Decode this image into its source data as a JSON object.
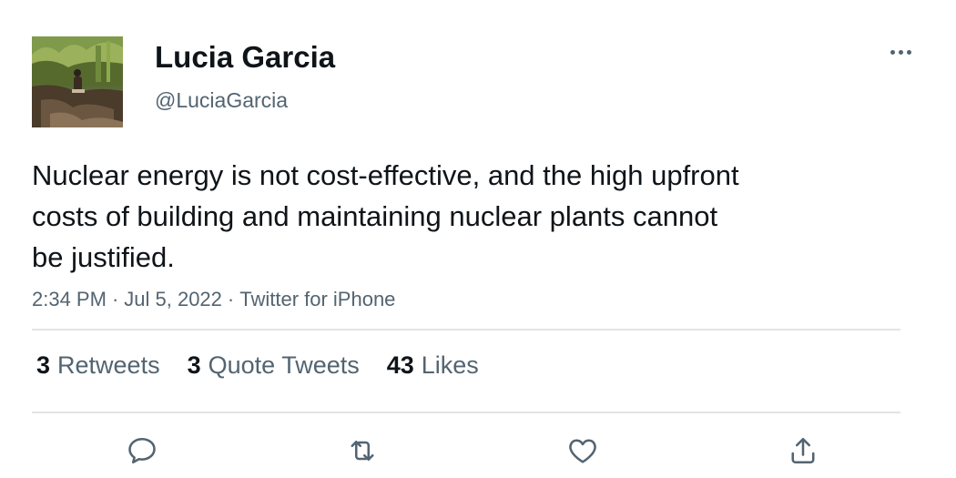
{
  "tweet": {
    "author": {
      "display_name": "Lucia Garcia",
      "handle": "@LuciaGarcia"
    },
    "text": "Nuclear energy is not cost-effective, and the high upfront costs of building and maintaining nuclear plants cannot be justified.",
    "time": "2:34 PM",
    "separator": "·",
    "date": "Jul 5, 2022",
    "source": "Twitter for iPhone"
  },
  "stats": {
    "retweets": {
      "count": "3",
      "label": "Retweets"
    },
    "quote_tweets": {
      "count": "3",
      "label": "Quote Tweets"
    },
    "likes": {
      "count": "43",
      "label": "Likes"
    }
  },
  "icons": {
    "more": "more-horizontal-icon",
    "reply": "reply-icon",
    "retweet": "retweet-icon",
    "like": "heart-icon",
    "share": "share-icon"
  },
  "colors": {
    "text_primary": "#0f1419",
    "text_secondary": "#536471",
    "divider": "#e1e4e6"
  }
}
